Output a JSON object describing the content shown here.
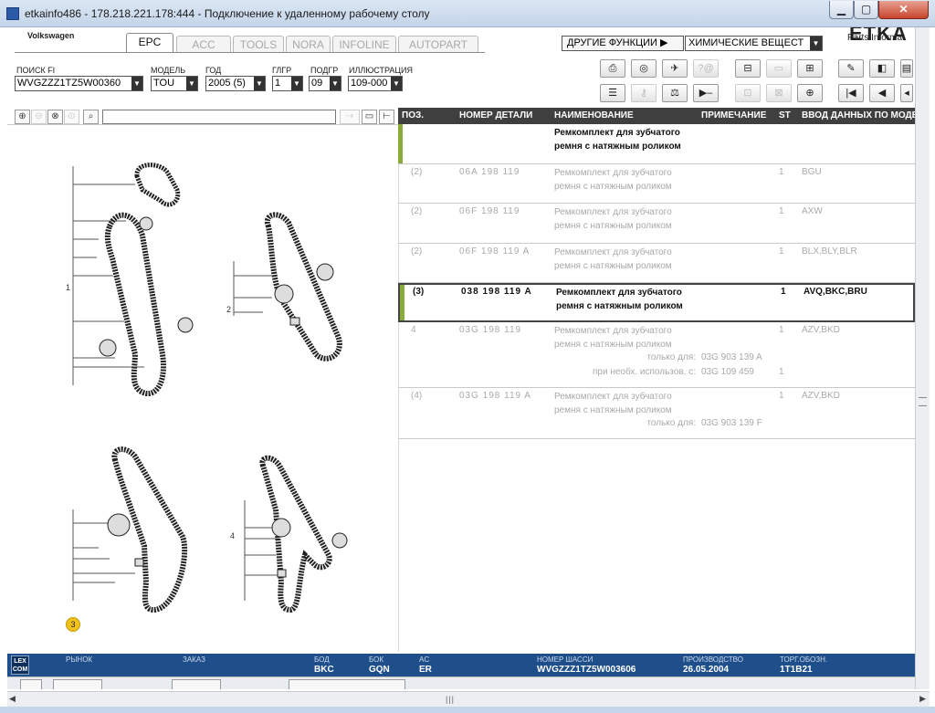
{
  "window": {
    "title": "etkainfo486 - 178.218.221.178:444 - Подключение к удаленному рабочему столу"
  },
  "brand": "Volkswagen",
  "logo": {
    "etka": "ETKA",
    "parts": "Parts Informat"
  },
  "tabs": [
    {
      "label": "EPC",
      "active": true
    },
    {
      "label": "ACC",
      "active": false
    },
    {
      "label": "TOOLS",
      "active": false
    },
    {
      "label": "NORA",
      "active": false
    },
    {
      "label": "INFOLINE",
      "active": false
    },
    {
      "label": "AUTOPART",
      "active": false
    }
  ],
  "other_functions": "ДРУГИЕ ФУНКЦИИ ▶",
  "chem_select": "ХИМИЧЕСКИЕ ВЕЩЕСТ",
  "filters": {
    "fi_label": "ПОИСК FI",
    "fi_value": "WVGZZZ1TZ5W00360",
    "model_label": "МОДЕЛЬ",
    "model_value": "TOU",
    "year_label": "ГОД",
    "year_value": "2005 (5)",
    "hg_label": "ГЛГР",
    "hg_value": "1",
    "sg_label": "ПОДГР",
    "sg_value": "09",
    "ill_label": "ИЛЛЮСТРАЦИЯ",
    "ill_value": "109-000"
  },
  "table": {
    "headers": {
      "pos": "ПОЗ.",
      "num": "НОМЕР ДЕТАЛИ",
      "name": "НАИМЕНОВАНИЕ",
      "note": "ПРИМЕЧАНИЕ",
      "st": "ST",
      "entry": "ВВОД ДАННЫХ ПО МОДЕЛИ"
    },
    "group_title": "Ремкомплект для зубчатого ремня с натяжным роликом",
    "rows": [
      {
        "pos": "(2)",
        "num": "06A  198  119",
        "name": "Ремкомплект для зубчатого ремня с натяжным роликом",
        "st": "1",
        "entry": "BGU"
      },
      {
        "pos": "(2)",
        "num": "06F  198  119",
        "name": "Ремкомплект для зубчатого ремня с натяжным роликом",
        "st": "1",
        "entry": "AXW"
      },
      {
        "pos": "(2)",
        "num": "06F  198  119  A",
        "name": "Ремкомплект для зубчатого ремня с натяжным роликом",
        "st": "1",
        "entry": "BLX,BLY,BLR"
      },
      {
        "pos": "(3)",
        "num": "038  198  119  A",
        "name": "Ремкомплект для зубчатого ремня с натяжным роликом",
        "st": "1",
        "entry": "AVQ,BKC,BRU"
      },
      {
        "pos": "4",
        "num": "03G  198  119",
        "name": "Ремкомплект для зубчатого ремня с натяжным роликом",
        "st": "1",
        "entry": "AZV,BKD",
        "extra1_label": "только для:",
        "extra1_value": "03G 903 139 A",
        "extra2_label": "при необх. использов. с:",
        "extra2_value": "03G 109 459",
        "extra2_st": "1"
      },
      {
        "pos": "(4)",
        "num": "03G  198  119  A",
        "name": "Ремкомплект для зубчатого ремня с натяжным роликом",
        "st": "1",
        "entry": "AZV,BKD",
        "extra1_label": "только для:",
        "extra1_value": "03G 903 139 F"
      }
    ]
  },
  "illustration": {
    "marker_selected": "3",
    "callouts": [
      "1",
      "2",
      "4"
    ]
  },
  "status": {
    "lex_logo": "LEX COM",
    "market_label": "РЫНОК",
    "market_value": "",
    "order_label": "ЗАКАЗ",
    "order_value": "",
    "bod_label": "БОД",
    "bod_value": "BKC",
    "bok_label": "БОК",
    "bok_value": "GQN",
    "ac_label": "AC",
    "ac_value": "ER",
    "chassis_label": "НОМЕР ШАССИ",
    "chassis_value": "WVGZZZ1TZ5W003606",
    "prod_label": "ПРОИЗВОДСТВО",
    "prod_value": "26.05.2004",
    "trade_label": "ТОРГ.ОБОЗН.",
    "trade_value": "1T1B21"
  },
  "colors": {
    "status_bar": "#1f4f8b",
    "group_marker": "#8aaa3c",
    "marker_yellow": "#f2c21b"
  }
}
